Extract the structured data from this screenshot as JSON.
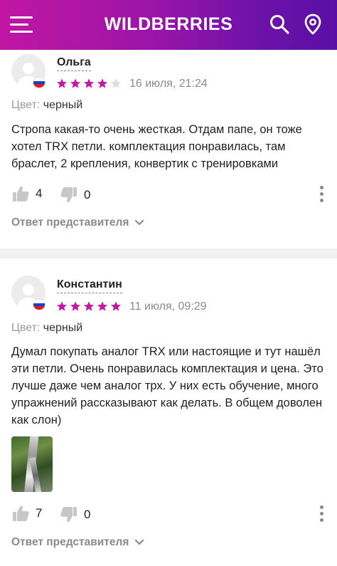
{
  "header": {
    "logo": "WILDBERRIES",
    "menu_icon": "hamburger-menu-icon",
    "search_icon": "search-icon",
    "location_icon": "location-pin-icon",
    "gradient": [
      "#c116a3",
      "#5a10a6"
    ]
  },
  "accent_color": "#c21aa4",
  "reviews": [
    {
      "author": "Ольга",
      "rating": 4,
      "max_rating": 5,
      "date": "16 июля, 21:24",
      "color_label": "Цвет:",
      "color_value": "черный",
      "text": "Стропа какая-то очень жесткая. Отдам папе, он тоже хотел TRX петли. комплектация понравилась, там браслет, 2 крепления, конвертик с тренировками",
      "likes": "4",
      "dislikes": "0",
      "reply_label": "Ответ представителя"
    },
    {
      "author": "Константин",
      "rating": 5,
      "max_rating": 5,
      "date": "11 июля, 09:29",
      "color_label": "Цвет:",
      "color_value": "черный",
      "text": "Думал покупать аналог TRX или настоящие и тут нашёл эти петли. Очень понравилась комплектация и цена. Это лучше даже чем аналог трх. У них есть обучение, много упражнений рассказывают как делать. В общем доволен как слон)",
      "has_photo": true,
      "likes": "7",
      "dislikes": "0",
      "reply_label": "Ответ представителя"
    }
  ]
}
